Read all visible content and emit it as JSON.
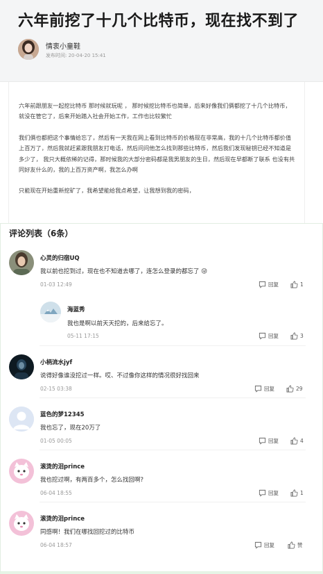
{
  "article": {
    "title": "六年前挖了十几个比特币，现在找不到了",
    "author": "情衷小童鞋",
    "publish_time": "发布时间: 20-04-20   15:41",
    "paragraphs": [
      "六年前跟朋友一起挖比特币 那时候就玩呢 ， 那时候挖比特币也简单，后来好像我们俩都挖了十几个比特币， 就没在管它了，后来开始踏入社会开始工作，工作也比较繁忙",
      "我们俩也都把这个事情给忘了，然后有一天我在网上看到比特币的价格现在非常高，我的十几个比特币都价值上百万了，然后我就赶紧跟我朋友打电话，然后问问他怎么找到那些比特币，然后我们发现秘钥已经不知道是多少了， 我只大概依稀的记得，那时候我的大部分密码都是我男朋友的生日，然后现在早都断了联系 也没有共同好友什么的，我的上百万资产啊，我怎么办啊",
      "只能现在开始重新挖矿了，我希望能给我点希望，让我想到我的密码，"
    ]
  },
  "comments_section": {
    "title": "评论列表（6条）",
    "reply_label": "回复",
    "comments": [
      {
        "name": "心灵的归宿UQ",
        "text": "我以前也挖到过，现在也不知道去哪了，连怎么登录的都忘了 😜",
        "time": "01-03 12:49",
        "likes": "1",
        "avatar": "photo-avatar"
      },
      {
        "name": "海蓝秀",
        "text": "我也是啊以前天天挖的，后来给忘了。",
        "time": "05-11 17:15",
        "likes": "3",
        "avatar": "snow-avatar"
      },
      {
        "name": "小柄流水jyf",
        "text": "说得好像谁没挖过一样。哎、不过像你这样的情况很好找回来",
        "time": "02-15 03:38",
        "likes": "29",
        "avatar": "dark-avatar"
      },
      {
        "name": "蓝色的梦12345",
        "text": "我也忘了，现在20万了",
        "time": "01-05 00:05",
        "likes": "4",
        "avatar": "default-avatar"
      },
      {
        "name": "滚烫的泪prince",
        "text": "我也挖过啊，有两百多个，怎么找回啊?",
        "time": "06-04 18:55",
        "likes": "1",
        "avatar": "pink-cat-avatar"
      },
      {
        "name": "滚烫的泪prince",
        "text": "同感啊！我们在哪找回挖过的比特币",
        "time": "06-04 18:57",
        "likes": "赞",
        "avatar": "pink-cat-avatar"
      }
    ]
  },
  "colors": {
    "accent_green": "#e6f4e6",
    "text_dark": "#222222",
    "muted": "#999999"
  }
}
